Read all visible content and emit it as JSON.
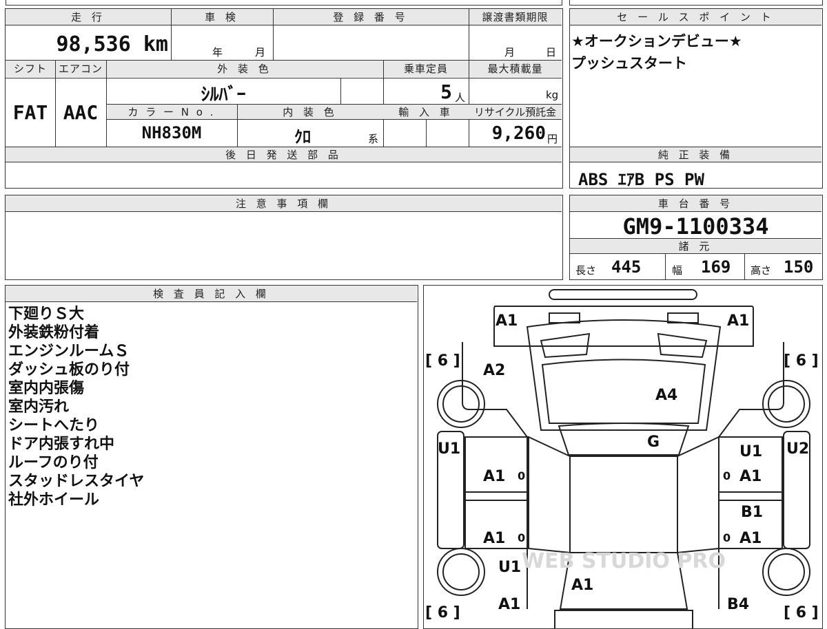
{
  "headers": {
    "mileage": "走 行",
    "shaken": "車 検",
    "registration": "登 録 番 号",
    "transfer_deadline": "譲渡書類期限",
    "shift": "シフト",
    "aircon": "エアコン",
    "exterior_color": "外 装 色",
    "capacity": "乗車定員",
    "max_load": "最大積載量",
    "color_no": "カ ラ ー N o .",
    "interior_color": "内 装 色",
    "import": "輸 入 車",
    "recycle": "リサイクル預託金",
    "later_parts": "後 日 発 送 部 品",
    "notes": "注 意 事 項 欄",
    "sales_points": "セ ー ル ス ポ イ ン ト",
    "genuine_equipment": "純 正 装 備",
    "chassis_no": "車 台 番 号",
    "specs": "諸 元",
    "inspector": "検 査 員 記 入 欄"
  },
  "vehicle": {
    "mileage": "98,536",
    "mileage_unit": "km",
    "shaken_year": "年",
    "shaken_month": "月",
    "transfer_month": "月",
    "transfer_day": "日",
    "shift": "FAT",
    "aircon": "AAC",
    "exterior_color": "ｼﾙﾊﾞｰ",
    "capacity": "5",
    "capacity_unit": "人",
    "max_load_unit": "kg",
    "color_no": "NH830M",
    "interior_color": "ｸﾛ",
    "interior_suffix": "系",
    "recycle": "9,260",
    "recycle_unit": "円"
  },
  "sales_points": [
    "★オークションデビュー★",
    "プッシュスタート"
  ],
  "genuine_equipment": "ABS ｴｱB PS PW",
  "chassis_no": "GM9-1100334",
  "specs": {
    "length_label": "長さ",
    "length": "445",
    "width_label": "幅",
    "width": "169",
    "height_label": "高さ",
    "height": "150"
  },
  "inspector_notes": [
    "下廻りＳ大",
    "外装鉄粉付着",
    "エンジンルームＳ",
    "ダッシュ板のり付",
    "室内内張傷",
    "室内汚れ",
    "シートへたり",
    "ドア内張すれ中",
    "ルーフのり付",
    "スタッドレスタイヤ",
    "社外ホイール"
  ],
  "diagram_marks": {
    "front_left": "A1",
    "front_right": "A1",
    "tire_fl": "[ 6 ]",
    "tire_fr": "[ 6 ]",
    "tire_rl": "[ 6 ]",
    "tire_rr": "[ 6 ]",
    "hood": "A2",
    "windshield": "A4",
    "roof_glass": "G",
    "left_panel": "U1",
    "right_fender": "U1",
    "right_side": "U2",
    "left_door_front": "A1",
    "right_door_front": "A1",
    "left_door_rear": "A1",
    "right_door_rear": "A1",
    "right_b1": "B1",
    "left_rear_u1": "U1",
    "trunk": "A1",
    "rear_left": "A1",
    "rear_right": "B4",
    "zero": "0"
  },
  "watermark": "WEB STUDIO PRO"
}
